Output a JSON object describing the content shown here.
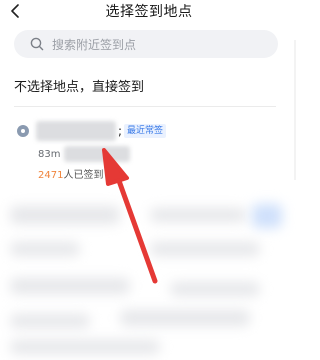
{
  "header": {
    "title": "选择签到地点",
    "back_icon": "chevron-left-icon"
  },
  "search": {
    "placeholder": "搜索附近签到点",
    "icon": "search-icon"
  },
  "no_location": {
    "label": "不选择地点，直接签到"
  },
  "location_item": {
    "separator": ";",
    "tag": "最近常签",
    "distance": "83m",
    "checkin_count": "2471",
    "checkin_suffix": "人已签到"
  },
  "colors": {
    "accent": "#3b7be8",
    "count": "#f0843c",
    "arrow": "#e53935"
  }
}
